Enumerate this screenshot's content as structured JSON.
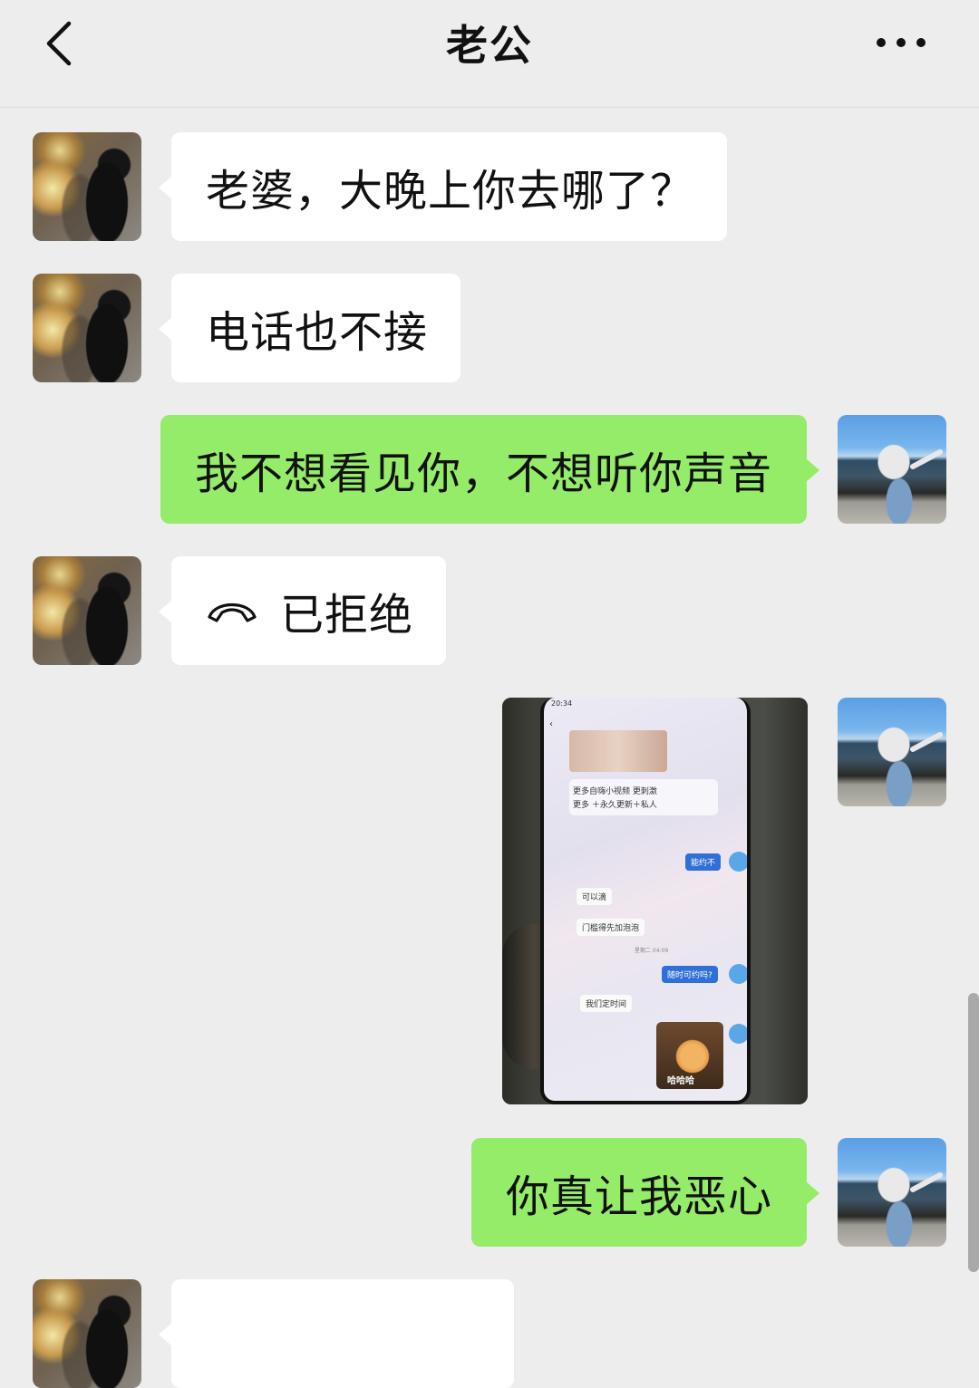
{
  "header": {
    "title": "老公",
    "back_icon": "chevron-left-icon",
    "more_icon": "more-horizontal-icon"
  },
  "messages": [
    {
      "from": "contact",
      "type": "text",
      "text": "老婆，大晚上你去哪了？"
    },
    {
      "from": "contact",
      "type": "text",
      "text": "电话也不接"
    },
    {
      "from": "me",
      "type": "text",
      "text": "我不想看见你，不想听你声音"
    },
    {
      "from": "contact",
      "type": "call",
      "icon": "phone-hangup-icon",
      "text": "已拒绝"
    },
    {
      "from": "me",
      "type": "image",
      "screenshot": {
        "time": "20:34",
        "line1": "更多自嗨小视频 更刺激",
        "line2": "更多 ＋永久更新＋私人",
        "bubbles": [
          "能约不",
          "可以滴",
          "门槛得先加泡泡",
          "随时可约吗?",
          "我们定时间"
        ],
        "date": "星期二 04:09",
        "sticker_text": "哈哈哈"
      }
    },
    {
      "from": "me",
      "type": "text",
      "text": "你真让我恶心"
    },
    {
      "from": "contact",
      "type": "text",
      "text": ""
    }
  ],
  "colors": {
    "background": "#ededed",
    "incoming_bubble": "#ffffff",
    "outgoing_bubble": "#95ec69"
  }
}
